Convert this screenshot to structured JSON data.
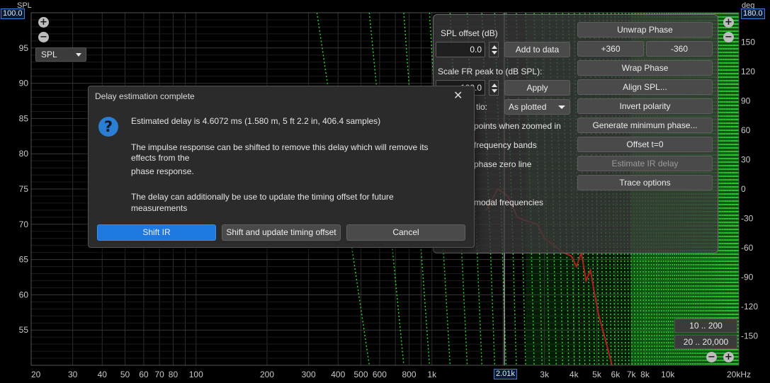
{
  "plot": {
    "left_axis_unit": "SPL",
    "right_axis_unit": "deg",
    "left_top_value": "100.0",
    "right_top_value": "180.0",
    "cursor_value": "2.01k",
    "left_ticks": [
      "95",
      "90",
      "85",
      "80",
      "75",
      "70",
      "65",
      "60",
      "55"
    ],
    "right_ticks": [
      "150",
      "120",
      "90",
      "60",
      "30",
      "0",
      "-30",
      "-60",
      "-90",
      "-120",
      "-150"
    ],
    "x_ticks": [
      "20",
      "30",
      "40",
      "50",
      "60",
      "70",
      "80",
      "100",
      "200",
      "300",
      "400",
      "500",
      "600",
      "800",
      "1k",
      "3k",
      "4k",
      "5k",
      "6k",
      "7k",
      "8k",
      "10k",
      "20kHz"
    ],
    "colors": {
      "phase_fill": "#1d9a22",
      "phase_trace": "#2bd02f",
      "spl_trace": "#b02020",
      "cursor": "#e0e0e0"
    }
  },
  "left_controls": {
    "zoom_in_icon": "plus-circle-icon",
    "zoom_out_icon": "minus-circle-icon",
    "trace_select": "SPL"
  },
  "right_controls": {
    "zoom_in_icon": "plus-circle-icon",
    "zoom_out_icon": "minus-circle-icon",
    "range_10_200": "10 .. 200",
    "range_20_20000": "20 .. 20,000"
  },
  "panel": {
    "spl_offset_label": "SPL offset (dB)",
    "spl_offset_value": "0.0",
    "add_to_data": "Add to data",
    "scale_label": "Scale FR peak to (dB SPL):",
    "scale_value": "100.0",
    "apply": "Apply",
    "ratio_label_partial": "tio:",
    "ratio_select": "As plotted",
    "option_points": "points when zoomed in",
    "option_bands": "frequency bands",
    "option_phase_zero": "phase zero line",
    "option_modal": "modal frequencies",
    "unwrap_phase": "Unwrap Phase",
    "plus360": "+360",
    "minus360": "-360",
    "wrap_phase": "Wrap Phase",
    "align_spl": "Align SPL...",
    "invert_polarity": "Invert polarity",
    "generate_min_phase": "Generate minimum phase...",
    "offset_t0": "Offset t=0",
    "estimate_ir_delay": "Estimate IR delay",
    "trace_options": "Trace options"
  },
  "dialog": {
    "title": "Delay estimation complete",
    "icon": "question-icon",
    "line1": "Estimated delay is 4.6072 ms (1.580 m, 5 ft 2.2 in, 406.4 samples)",
    "line2a": "The impulse response can be shifted to remove this delay which will remove its",
    "line2b": "effects from the",
    "line2c": "phase response.",
    "line3a": "The delay can additionally be use to update the timing offset for future",
    "line3b": "measurements",
    "btn_shift": "Shift IR",
    "btn_shift_update": "Shift and update timing offset",
    "btn_cancel": "Cancel"
  }
}
